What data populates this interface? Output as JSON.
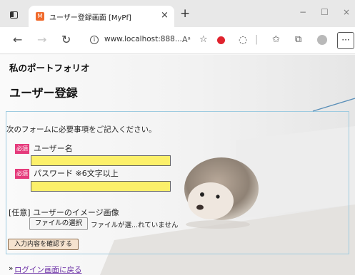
{
  "browser": {
    "tab": {
      "favicon_glyph": "M",
      "title": "ユーザー登録画面 [MyPf]",
      "close_glyph": "×"
    },
    "new_tab_glyph": "+",
    "window_controls": {
      "minimize": "−",
      "maximize": "☐",
      "close": "×"
    },
    "nav": {
      "back": "←",
      "forward": "→",
      "reload": "↻"
    },
    "address": {
      "info_glyph": "i",
      "url": "www.localhost:888..."
    },
    "toolbar_icons": {
      "read_aloud": "Aᵃ",
      "favorites_add": "☆",
      "ext_icon": "◌",
      "favorites": "✩",
      "collections": "⧉",
      "more": "···"
    }
  },
  "page": {
    "site_title": "私のポートフォリオ",
    "heading": "ユーザー登録",
    "intro": "次のフォームに必要事項をご記入ください。",
    "fields": {
      "username": {
        "badge": "必須",
        "label": "ユーザー名",
        "value": ""
      },
      "password": {
        "badge": "必須",
        "label": "パスワード ※6文字以上",
        "value": ""
      },
      "image": {
        "label": "[任意] ユーザーのイメージ画像",
        "button": "ファイルの選択",
        "status": "ファイルが選...れていません"
      }
    },
    "submit_label": "入力内容を確認する",
    "back_prefix": "»",
    "back_link": "ログイン画面に戻る"
  },
  "colors": {
    "required_badge": "#e53b7c",
    "input_fill": "#fcf06a",
    "form_border": "#9ecbe0",
    "callout": "#5a8fb8",
    "link": "#6b2fa6"
  }
}
